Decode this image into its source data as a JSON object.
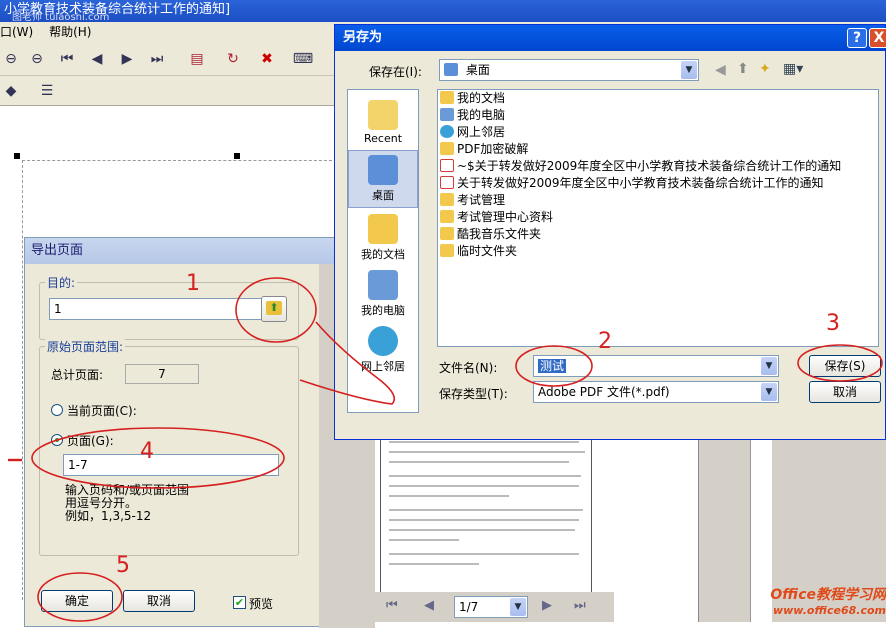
{
  "background_app": {
    "title": "小学教育技术装备综合统计工作的通知]",
    "watermark_top": "图老师 tulaoshi.com",
    "menu": [
      "口(W)",
      "帮助(H)"
    ]
  },
  "export_dialog": {
    "title": "导出页面",
    "target_group": "目的:",
    "target_value": "1",
    "range_group": "原始页面范围:",
    "total_label": "总计页面:",
    "total_value": "7",
    "current_page_label": "当前页面(C):",
    "pages_label": "页面(G):",
    "pages_value": "1-7",
    "hint_lines": [
      "输入页码和/或页面范围",
      "用逗号分开。",
      "例如，1,3,5-12"
    ],
    "ok_label": "确定",
    "cancel_label": "取消",
    "preview_label": "预览",
    "preview_checked": true,
    "pager_value": "1/7"
  },
  "save_dialog": {
    "title": "另存为",
    "help_btn": "?",
    "close_btn": "X",
    "save_in_label": "保存在(I):",
    "save_in_value": "桌面",
    "places": [
      {
        "label": "Recent",
        "icon": "recent-icon"
      },
      {
        "label": "桌面",
        "icon": "desktop-icon"
      },
      {
        "label": "我的文档",
        "icon": "my-documents-icon"
      },
      {
        "label": "我的电脑",
        "icon": "my-computer-icon"
      },
      {
        "label": "网上邻居",
        "icon": "network-icon"
      }
    ],
    "files": [
      {
        "name": "我的文档",
        "icon": "my-documents-icon",
        "color": "#f2c94c"
      },
      {
        "name": "我的电脑",
        "icon": "my-computer-icon",
        "color": "#6a9bd8"
      },
      {
        "name": "网上邻居",
        "icon": "network-icon",
        "color": "#3aa0d8"
      },
      {
        "name": "PDF加密破解",
        "icon": "folder-icon",
        "color": "#f2c94c"
      },
      {
        "name": "~$关于转发做好2009年度全区中小学教育技术装备综合统计工作的通知",
        "icon": "pdf-icon",
        "color": "#d83a3a"
      },
      {
        "name": "关于转发做好2009年度全区中小学教育技术装备综合统计工作的通知",
        "icon": "pdf-icon",
        "color": "#d83a3a"
      },
      {
        "name": "考试管理",
        "icon": "folder-shortcut-icon",
        "color": "#f2c94c"
      },
      {
        "name": "考试管理中心资料",
        "icon": "folder-shortcut-icon",
        "color": "#f2c94c"
      },
      {
        "name": "酷我音乐文件夹",
        "icon": "music-folder-icon",
        "color": "#f2c94c"
      },
      {
        "name": "临时文件夹",
        "icon": "folder-icon",
        "color": "#f2c94c"
      }
    ],
    "filename_label": "文件名(N):",
    "filename_value": "测试",
    "filetype_label": "保存类型(T):",
    "filetype_value": "Adobe PDF 文件(*.pdf)",
    "save_button": "保存(S)",
    "cancel_button": "取消"
  },
  "annotations": [
    "1",
    "2",
    "3",
    "4",
    "5"
  ],
  "watermark": {
    "line1": "Office教程学习网",
    "line2": "www.office68.com"
  }
}
